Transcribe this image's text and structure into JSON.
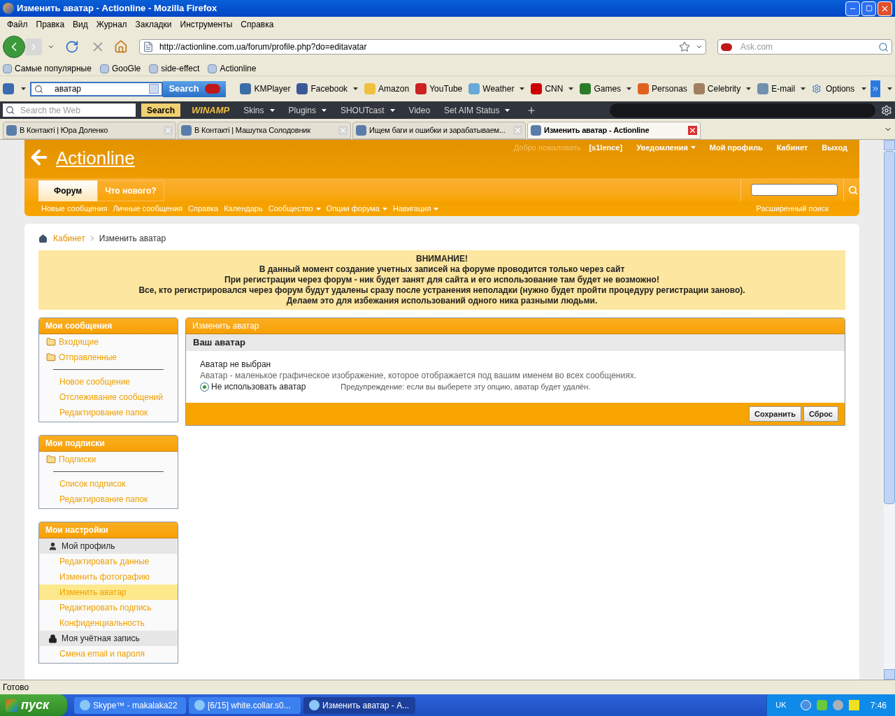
{
  "window": {
    "title": "Изменить аватар - Actionline - Mozilla Firefox"
  },
  "menu": [
    "Файл",
    "Правка",
    "Вид",
    "Журнал",
    "Закладки",
    "Инструменты",
    "Справка"
  ],
  "nav": {
    "url": "http://actionline.com.ua/forum/profile.php?do=editavatar",
    "search_placeholder": "Ask.com"
  },
  "bookmarks": [
    "Самые популярные",
    "GooGle",
    "side-effect",
    "Actionline"
  ],
  "ask_toolbar": {
    "search_value": "аватар",
    "search_button": "Search",
    "items": [
      {
        "label": "KMPlayer",
        "dropdown": false
      },
      {
        "label": "Facebook",
        "dropdown": true
      },
      {
        "label": "Amazon",
        "dropdown": false
      },
      {
        "label": "YouTube",
        "dropdown": false
      },
      {
        "label": "Weather",
        "dropdown": true
      },
      {
        "label": "CNN",
        "dropdown": true
      },
      {
        "label": "Games",
        "dropdown": true
      },
      {
        "label": "Personas",
        "dropdown": false
      },
      {
        "label": "Celebrity",
        "dropdown": true
      },
      {
        "label": "E-mail",
        "dropdown": true
      }
    ],
    "options": "Options"
  },
  "winamp": {
    "search_placeholder": "Search the Web",
    "search_button": "Search",
    "logo": "WINAMP",
    "items": [
      {
        "label": "Skins",
        "dropdown": true
      },
      {
        "label": "Plugins",
        "dropdown": true
      },
      {
        "label": "SHOUTcast",
        "dropdown": true
      },
      {
        "label": "Video",
        "dropdown": false
      },
      {
        "label": "Set AIM Status",
        "dropdown": true
      }
    ]
  },
  "tabs": [
    {
      "label": "В Контакті | Юра Доленко",
      "selected": false
    },
    {
      "label": "В Контакті | Машутка Солодовник",
      "selected": false
    },
    {
      "label": "Ищем баги и ошибки и зарабатываем...",
      "selected": false
    },
    {
      "label": "Изменить аватар - Actionline",
      "selected": true
    }
  ],
  "page": {
    "header": {
      "logo": "Actionline",
      "welcome": "Добро пожаловать",
      "user": "[s1lence]",
      "links": [
        {
          "label": "Уведомления",
          "dropdown": true
        },
        {
          "label": "Мой профиль",
          "dropdown": false
        },
        {
          "label": "Кабинет",
          "dropdown": false
        },
        {
          "label": "Выход",
          "dropdown": false
        }
      ]
    },
    "nav_tabs": [
      {
        "label": "Форум",
        "selected": true
      },
      {
        "label": "Что нового?",
        "selected": false
      }
    ],
    "subnav": [
      {
        "label": "Новые сообщения",
        "dropdown": false
      },
      {
        "label": "Личные сообщения",
        "dropdown": false
      },
      {
        "label": "Справка",
        "dropdown": false
      },
      {
        "label": "Календарь",
        "dropdown": false
      },
      {
        "label": "Сообщество",
        "dropdown": true
      },
      {
        "label": "Опции форума",
        "dropdown": true
      },
      {
        "label": "Навигация",
        "dropdown": true
      }
    ],
    "advanced_search": "Расширенный поиск",
    "breadcrumb": [
      "Кабинет",
      "Изменить аватар"
    ],
    "notice": [
      "ВНИМАНИЕ!",
      "В данный момент создание учетных записей на форуме проводится только через сайт",
      "При регистрации через форум - ник будет занят для сайта и его использование там будет не возможно!",
      "Все, кто регистрировался через форум будут удалены сразу после устранения неполадки (нужно будет пройти процедуру регистрации заново).",
      "Делаем это для избежания использований одного ника разными людьми."
    ],
    "sidebar": [
      {
        "title": "Мои сообщения",
        "items": [
          {
            "kind": "folder",
            "label": "Входящие",
            "selected": false
          },
          {
            "kind": "folder",
            "label": "Отправленные",
            "selected": false
          },
          {
            "kind": "divider"
          },
          {
            "kind": "link",
            "label": "Новое сообщение",
            "selected": false
          },
          {
            "kind": "link",
            "label": "Отслеживание сообщений",
            "selected": false
          },
          {
            "kind": "link",
            "label": "Редактирование папок",
            "selected": false
          }
        ]
      },
      {
        "title": "Мои подписки",
        "items": [
          {
            "kind": "folder",
            "label": "Подписки",
            "selected": false
          },
          {
            "kind": "divider"
          },
          {
            "kind": "link",
            "label": "Список подписок",
            "selected": false
          },
          {
            "kind": "link",
            "label": "Редактирование папок",
            "selected": false
          }
        ]
      },
      {
        "title": "Мои настройки",
        "items": [
          {
            "kind": "profile",
            "label": "Мой профиль"
          },
          {
            "kind": "link",
            "label": "Редактировать данные",
            "selected": false
          },
          {
            "kind": "link",
            "label": "Изменить фотографию",
            "selected": false
          },
          {
            "kind": "link",
            "label": "Изменить аватар",
            "selected": true
          },
          {
            "kind": "link",
            "label": "Редактировать подпись",
            "selected": false
          },
          {
            "kind": "link",
            "label": "Конфиденциальность",
            "selected": false
          },
          {
            "kind": "account",
            "label": "Моя учётная запись"
          },
          {
            "kind": "link",
            "label": "Смена email и пароля",
            "selected": false
          }
        ]
      }
    ],
    "main": {
      "title": "Изменить аватар",
      "section": "Ваш аватар",
      "status": "Аватар не выбран",
      "description": "Аватар - маленькое графическое изображение, которое отображается под вашим именем во всех сообщениях.",
      "option": {
        "label": "Не использовать аватар",
        "selected": true
      },
      "warning": "Предупреждение: если вы выберете эту опцию, аватар будет удалён.",
      "buttons": [
        "Сохранить",
        "Сброс"
      ]
    }
  },
  "status_bar": "Готово",
  "taskbar": {
    "start": "пуск",
    "tasks": [
      {
        "label": "Skype™ - makalaka22",
        "selected": false
      },
      {
        "label": "[6/15] white.collar.s0...",
        "selected": false
      },
      {
        "label": "Изменить аватар - А...",
        "selected": true
      }
    ],
    "lang": "UK",
    "time": "7:46"
  }
}
